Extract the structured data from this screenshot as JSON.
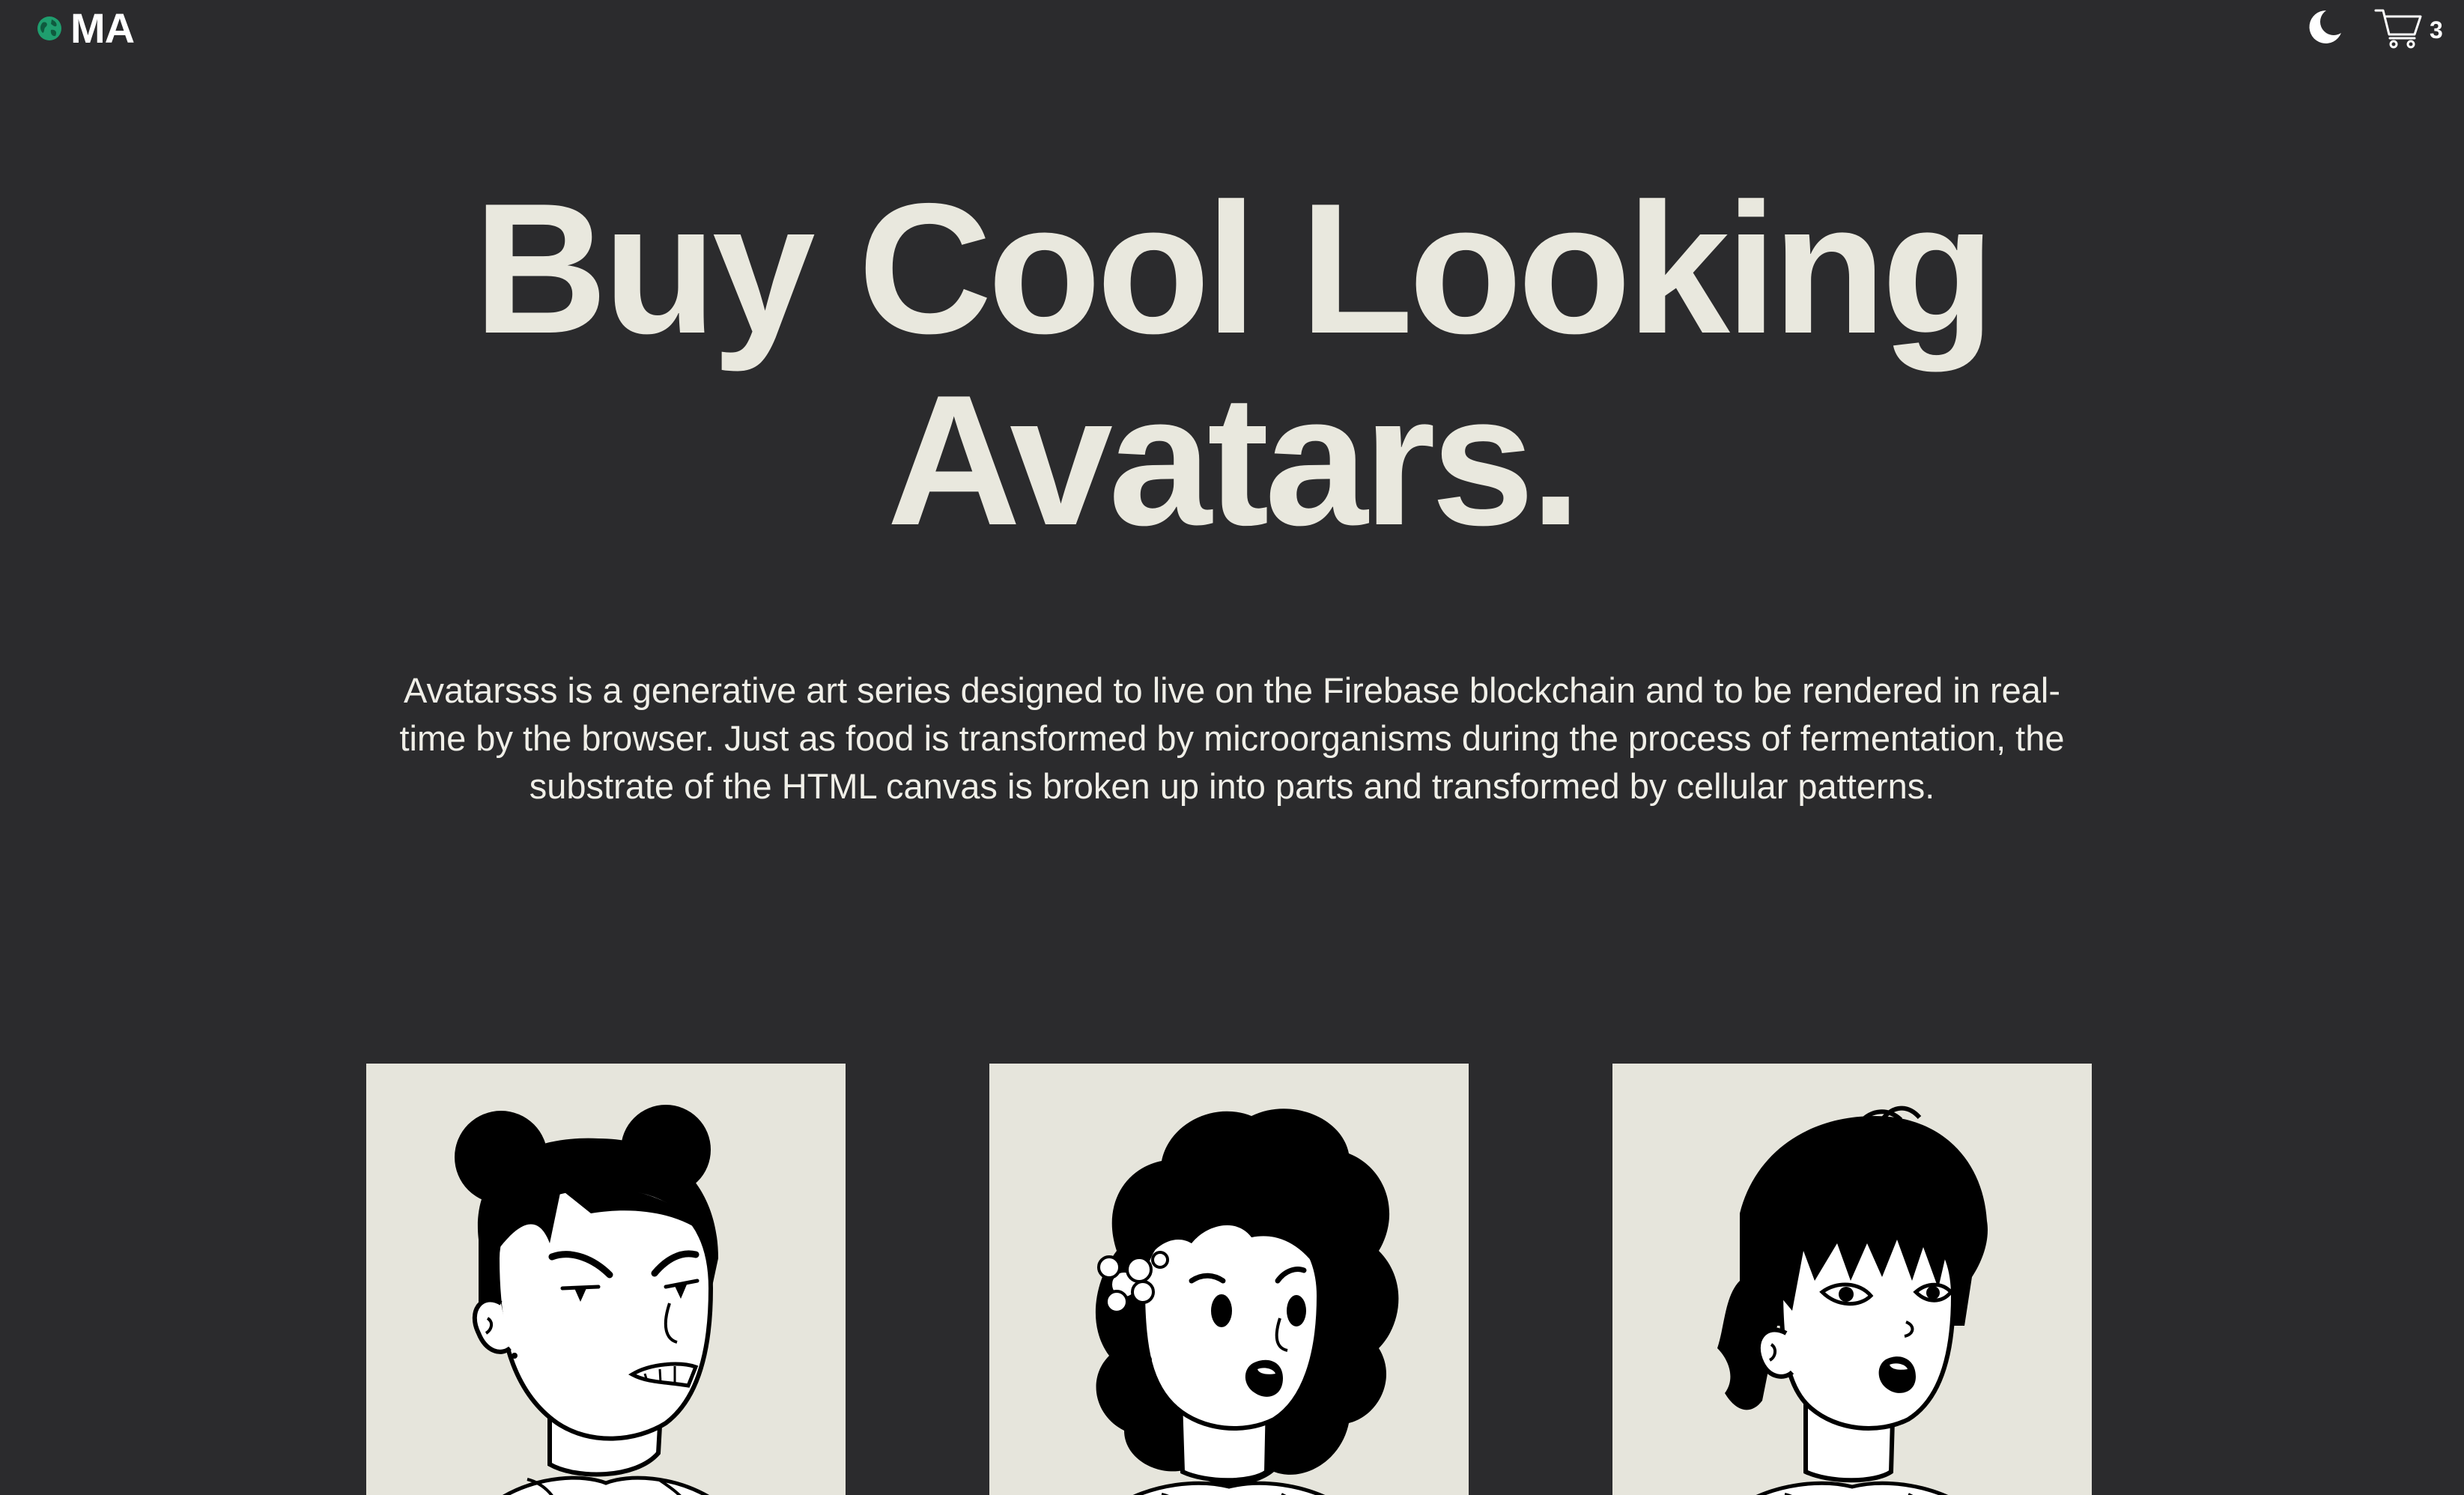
{
  "header": {
    "brand_text": "MA",
    "brand_logo_icon": "globe-icon",
    "theme_icon": "moon-icon",
    "cart_icon": "cart-icon",
    "cart_count": "3"
  },
  "hero": {
    "title_line1": "Buy Cool Looking",
    "title_line2": "Avatars.",
    "description": "Avatarsss is a generative art series designed to live on the Firebase blockchain and to be rendered in real-time by the browser. Just as food is transformed by microorganisms during the process of fermentation, the substrate of the HTML canvas is broken up into parts and transformed by cellular patterns."
  },
  "avatars": [
    {
      "name": "avatar-bun-hair",
      "illustration": "woman with double buns, annoyed expression"
    },
    {
      "name": "avatar-curly-hair",
      "illustration": "woman with curly hair and flower, surprised expression"
    },
    {
      "name": "avatar-short-hair",
      "illustration": "woman with short choppy hair, surprised expression"
    }
  ],
  "colors": {
    "background": "#2b2b2d",
    "title": "#e9e8de",
    "card_bg": "#e6e5dc",
    "logo_accent": "#1f9e6e"
  }
}
